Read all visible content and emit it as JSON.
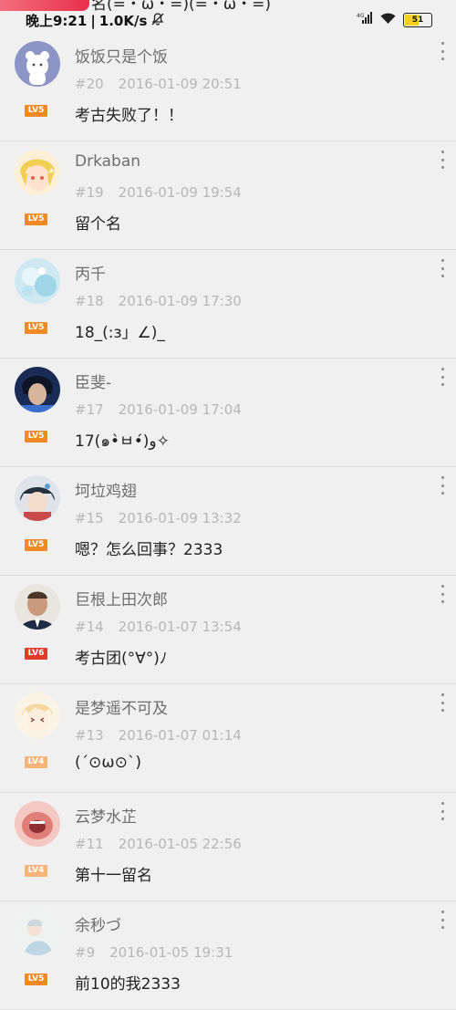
{
  "status_bar": {
    "ticker_text": "名(=・ω・=)(=・ω・=)",
    "time": "晚上9:21",
    "separator": "|",
    "speed": "1.0K/s",
    "battery": "51",
    "icons": [
      "mute-bell-icon",
      "signal-icon",
      "wifi-icon",
      "battery-icon"
    ]
  },
  "comments": [
    {
      "user": "饭饭只是个饭",
      "floor": "#20",
      "time": "2016-01-09 20:51",
      "text": "考古失败了！！",
      "level": "LV5"
    },
    {
      "user": "Drkaban",
      "floor": "#19",
      "time": "2016-01-09 19:54",
      "text": "留个名",
      "level": "LV5"
    },
    {
      "user": "丙千",
      "floor": "#18",
      "time": "2016-01-09 17:30",
      "text": "18_(:з」∠)_",
      "level": "LV5"
    },
    {
      "user": "臣斐-",
      "floor": "#17",
      "time": "2016-01-09 17:04",
      "text": "17(๑•̀ㅂ•́)و✧",
      "level": "LV5"
    },
    {
      "user": "坷垃鸡翅",
      "floor": "#15",
      "time": "2016-01-09 13:32",
      "text": "嗯？怎么回事？2333",
      "level": "LV5"
    },
    {
      "user": "巨根上田次郎",
      "floor": "#14",
      "time": "2016-01-07 13:54",
      "text": "考古团(°∀°)ﾉ",
      "level": "LV6"
    },
    {
      "user": "是梦遥不可及",
      "floor": "#13",
      "time": "2016-01-07 01:14",
      "text": "(´⊙ω⊙`)",
      "level": "LV4"
    },
    {
      "user": "云梦水芷",
      "floor": "#11",
      "time": "2016-01-05 22:56",
      "text": "第十一留名",
      "level": "LV4"
    },
    {
      "user": "余秒づ",
      "floor": "#9",
      "time": "2016-01-05 19:31",
      "text": "前10的我2333",
      "level": "LV5"
    }
  ],
  "colors": {
    "lv4": "#f6b37a",
    "lv5": "#f08a24",
    "lv6": "#e23b2e"
  }
}
